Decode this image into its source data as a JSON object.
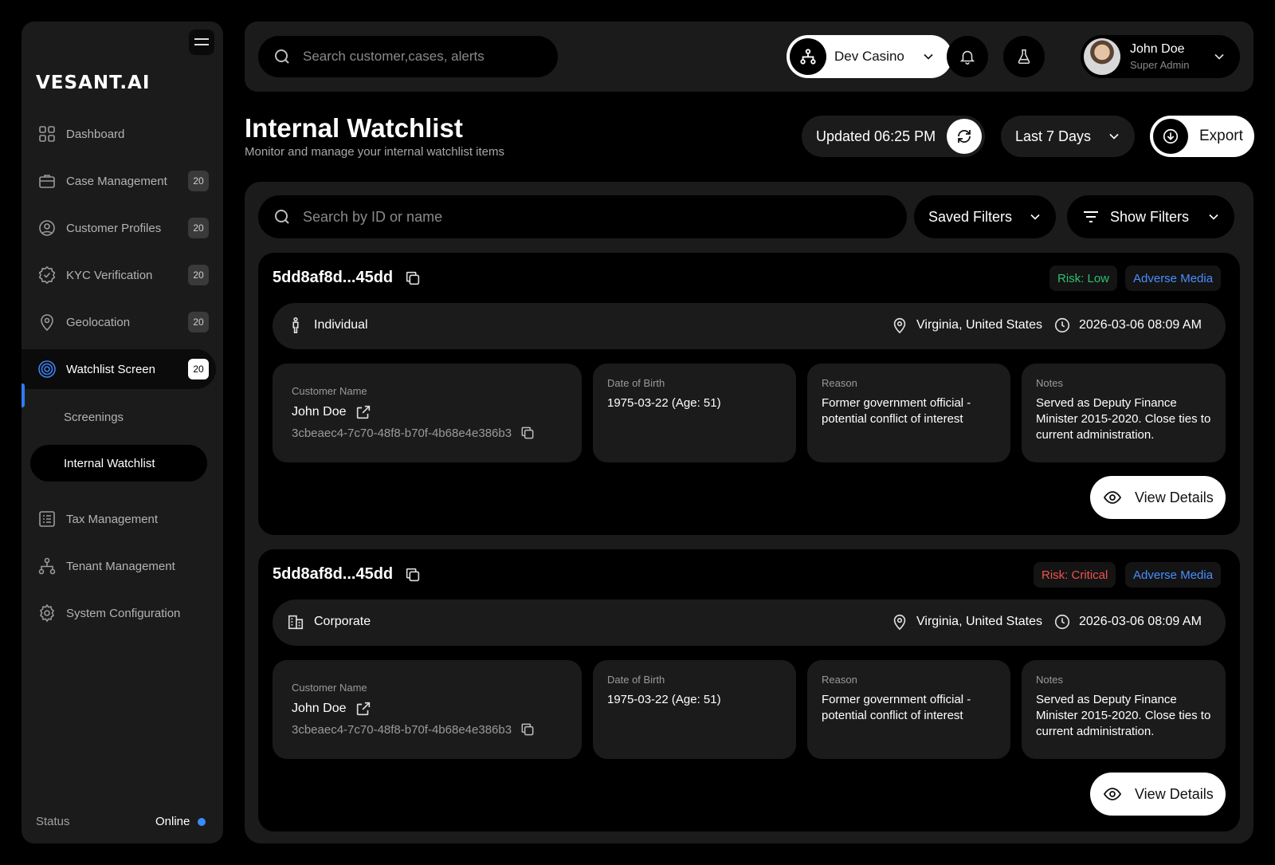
{
  "sidebar": {
    "logo": "VESANT.AI",
    "items": [
      {
        "label": "Dashboard",
        "icon": "dashboard-icon",
        "badge": null
      },
      {
        "label": "Case Management",
        "icon": "briefcase-icon",
        "badge": "20"
      },
      {
        "label": "Customer Profiles",
        "icon": "user-circle-icon",
        "badge": "20"
      },
      {
        "label": "KYC Verification",
        "icon": "verified-badge-icon",
        "badge": "20"
      },
      {
        "label": "Geolocation",
        "icon": "map-pin-icon",
        "badge": "20"
      },
      {
        "label": "Watchlist Screen",
        "icon": "target-icon",
        "badge": "20"
      },
      {
        "label": "Tax Management",
        "icon": "tax-list-icon",
        "badge": null
      },
      {
        "label": "Tenant Management",
        "icon": "hierarchy-icon",
        "badge": null
      },
      {
        "label": "System Configuration",
        "icon": "gear-icon",
        "badge": null
      }
    ],
    "subitems": [
      "Screenings",
      "Internal Watchlist"
    ],
    "status_label": "Status",
    "status_value": "Online"
  },
  "topbar": {
    "search_placeholder": "Search customer,cases, alerts",
    "tenant": "Dev Casino",
    "user_name": "John Doe",
    "user_role": "Super Admin"
  },
  "header": {
    "title": "Internal Watchlist",
    "subtitle": "Monitor and manage your internal watchlist items",
    "updated": "Updated 06:25 PM",
    "period": "Last 7 Days",
    "export": "Export"
  },
  "filters": {
    "search_placeholder": "Search by ID or name",
    "saved": "Saved Filters",
    "show": "Show Filters"
  },
  "labels": {
    "customer_name": "Customer Name",
    "dob": "Date of Birth",
    "reason": "Reason",
    "notes": "Notes",
    "view_details": "View Details"
  },
  "entries": [
    {
      "id": "5dd8af8d...45dd",
      "risk": "Risk: Low",
      "category": "Adverse Media",
      "type": "Individual",
      "location": "Virginia, United States",
      "datetime": "2026-03-06 08:09 AM",
      "customer_name": "John Doe",
      "customer_id": "3cbeaec4-7c70-48f8-b70f-4b68e4e386b3",
      "dob": "1975-03-22 (Age: 51)",
      "reason": "Former government official - potential conflict of interest",
      "notes": "Served as Deputy Finance Minister 2015-2020. Close ties to current administration."
    },
    {
      "id": "5dd8af8d...45dd",
      "risk": "Risk: Critical",
      "category": "Adverse Media",
      "type": "Corporate",
      "location": "Virginia, United States",
      "datetime": "2026-03-06 08:09 AM",
      "customer_name": "John Doe",
      "customer_id": "3cbeaec4-7c70-48f8-b70f-4b68e4e386b3",
      "dob": "1975-03-22 (Age: 51)",
      "reason": "Former government official - potential conflict of interest",
      "notes": "Served as Deputy Finance Minister 2015-2020. Close ties to current administration."
    }
  ],
  "colors": {
    "risk_low": "#2fbf71",
    "risk_critical": "#f0524f",
    "adverse_media": "#4a8dff",
    "accent": "#2f7cf6"
  }
}
